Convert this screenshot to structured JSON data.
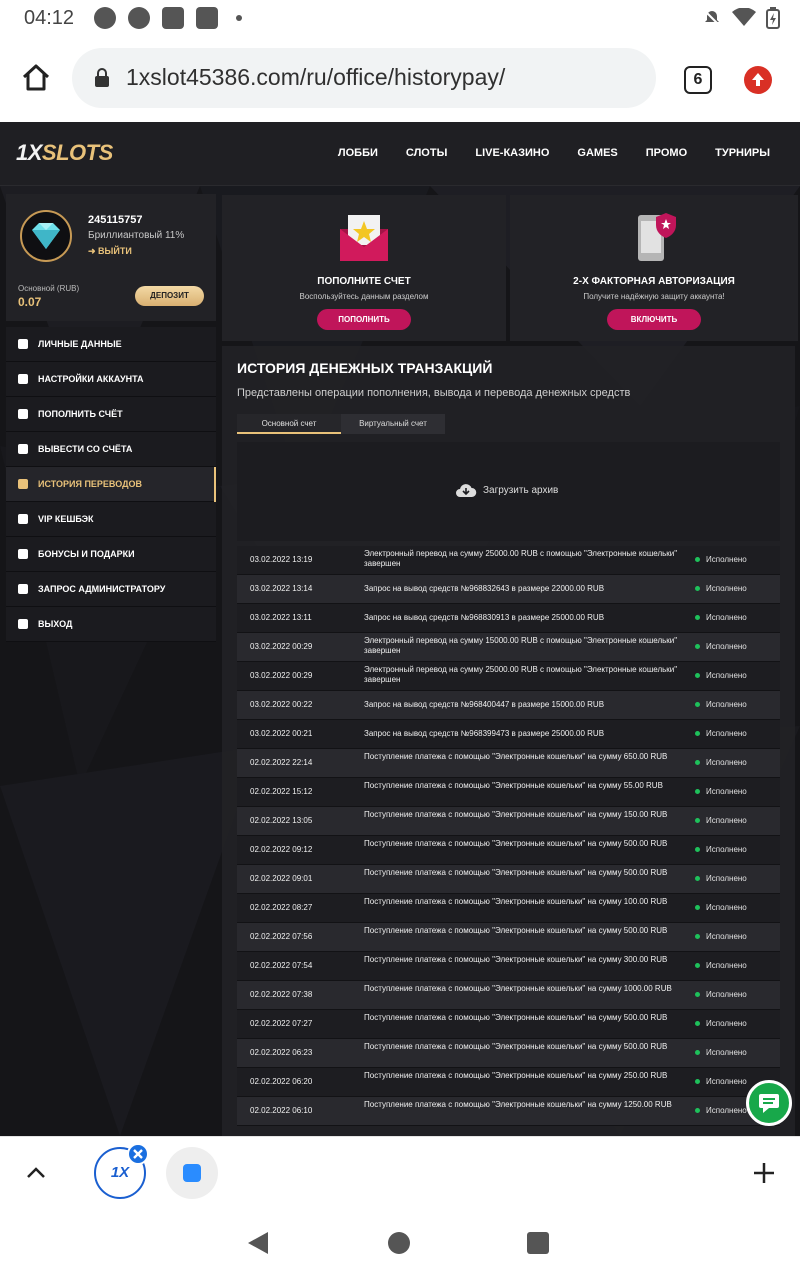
{
  "status_bar": {
    "time": "04:12"
  },
  "browser": {
    "url": "1xslot45386.com/ru/office/historypay/",
    "tab_count": "6"
  },
  "site": {
    "logo_1x": "1X",
    "logo_slots": "SLOTS",
    "nav": [
      "ЛОББИ",
      "СЛОТЫ",
      "LIVE-КАЗИНО",
      "GAMES",
      "ПРОМО",
      "ТУРНИРЫ"
    ]
  },
  "profile": {
    "id": "245115757",
    "level": "Бриллиантовый 11%",
    "logout": "ВЫЙТИ",
    "balance_label": "Основной (RUB)",
    "balance": "0.07",
    "deposit_button": "ДЕПОЗИТ"
  },
  "sidebar": {
    "items": [
      {
        "label": "ЛИЧНЫЕ ДАННЫЕ",
        "icon": "user-icon"
      },
      {
        "label": "НАСТРОЙКИ АККАУНТА",
        "icon": "gear-icon"
      },
      {
        "label": "ПОПОЛНИТЬ СЧЁТ",
        "icon": "download-icon"
      },
      {
        "label": "ВЫВЕСТИ СО СЧЁТА",
        "icon": "upload-icon"
      },
      {
        "label": "ИСТОРИЯ ПЕРЕВОДОВ",
        "icon": "transfer-icon",
        "active": true
      },
      {
        "label": "VIP КЕШБЭК",
        "icon": "crown-icon"
      },
      {
        "label": "БОНУСЫ И ПОДАРКИ",
        "icon": "gift-icon"
      },
      {
        "label": "ЗАПРОС АДМИНИСТРАТОРУ",
        "icon": "envelope-icon"
      },
      {
        "label": "ВЫХОД",
        "icon": "exit-icon"
      }
    ]
  },
  "promos": [
    {
      "title": "ПОПОЛНИТЕ СЧЕТ",
      "desc": "Воспользуйтесь данным разделом",
      "button": "ПОПОЛНИТЬ",
      "icon": "envelope-star-icon"
    },
    {
      "title": "2-Х ФАКТОРНАЯ АВТОРИЗАЦИЯ",
      "desc": "Получите надёжную защиту аккаунта!",
      "button": "ВКЛЮЧИТЬ",
      "icon": "phone-shield-icon"
    }
  ],
  "history": {
    "title": "ИСТОРИЯ ДЕНЕЖНЫХ ТРАНЗАКЦИЙ",
    "subtitle": "Представлены операции пополнения, вывода и перевода денежных средств",
    "tabs": [
      "Основной счет",
      "Виртуальный счет"
    ],
    "archive_label": "Загрузить архив",
    "rows": [
      {
        "date": "03.02.2022 13:19",
        "desc": "Электронный перевод на сумму 25000.00 RUB с помощью \"Электронные кошельки\" завершен",
        "status": "Исполнено"
      },
      {
        "date": "03.02.2022 13:14",
        "desc": "Запрос на вывод средств №968832643 в размере 22000.00 RUB",
        "status": "Исполнено"
      },
      {
        "date": "03.02.2022 13:11",
        "desc": "Запрос на вывод средств №968830913 в размере 25000.00 RUB",
        "status": "Исполнено"
      },
      {
        "date": "03.02.2022 00:29",
        "desc": "Электронный перевод на сумму 15000.00 RUB с помощью \"Электронные кошельки\" завершен",
        "status": "Исполнено"
      },
      {
        "date": "03.02.2022 00:29",
        "desc": "Электронный перевод на сумму 25000.00 RUB с помощью \"Электронные кошельки\" завершен",
        "status": "Исполнено"
      },
      {
        "date": "03.02.2022 00:22",
        "desc": "Запрос на вывод средств №968400447 в размере 15000.00 RUB",
        "status": "Исполнено"
      },
      {
        "date": "03.02.2022 00:21",
        "desc": "Запрос на вывод средств №968399473 в размере 25000.00 RUB",
        "status": "Исполнено"
      },
      {
        "date": "02.02.2022 22:14",
        "desc": "Поступление платежа с помощью \"Электронные кошельки\" на сумму 650.00 RUB",
        "status": "Исполнено"
      },
      {
        "date": "02.02.2022 15:12",
        "desc": "Поступление платежа с помощью \"Электронные кошельки\" на сумму 55.00 RUB",
        "status": "Исполнено"
      },
      {
        "date": "02.02.2022 13:05",
        "desc": "Поступление платежа с помощью \"Электронные кошельки\" на сумму 150.00 RUB",
        "status": "Исполнено"
      },
      {
        "date": "02.02.2022 09:12",
        "desc": "Поступление платежа с помощью \"Электронные кошельки\" на сумму 500.00 RUB",
        "status": "Исполнено"
      },
      {
        "date": "02.02.2022 09:01",
        "desc": "Поступление платежа с помощью \"Электронные кошельки\" на сумму 500.00 RUB",
        "status": "Исполнено"
      },
      {
        "date": "02.02.2022 08:27",
        "desc": "Поступление платежа с помощью \"Электронные кошельки\" на сумму 100.00 RUB",
        "status": "Исполнено"
      },
      {
        "date": "02.02.2022 07:56",
        "desc": "Поступление платежа с помощью \"Электронные кошельки\" на сумму 500.00 RUB",
        "status": "Исполнено"
      },
      {
        "date": "02.02.2022 07:54",
        "desc": "Поступление платежа с помощью \"Электронные кошельки\" на сумму 300.00 RUB",
        "status": "Исполнено"
      },
      {
        "date": "02.02.2022 07:38",
        "desc": "Поступление платежа с помощью \"Электронные кошельки\" на сумму 1000.00 RUB",
        "status": "Исполнено"
      },
      {
        "date": "02.02.2022 07:27",
        "desc": "Поступление платежа с помощью \"Электронные кошельки\" на сумму 500.00 RUB",
        "status": "Исполнено"
      },
      {
        "date": "02.02.2022 06:23",
        "desc": "Поступление платежа с помощью \"Электронные кошельки\" на сумму 500.00 RUB",
        "status": "Исполнено"
      },
      {
        "date": "02.02.2022 06:20",
        "desc": "Поступление платежа с помощью \"Электронные кошельки\" на сумму 250.00 RUB",
        "status": "Исполнено"
      },
      {
        "date": "02.02.2022 06:10",
        "desc": "Поступление платежа с помощью \"Электронные кошельки\" на сумму 1250.00 RUB",
        "status": "Исполнено"
      }
    ]
  },
  "bottom_bar": {
    "tab_thumb_text": "1X"
  },
  "colors": {
    "accent": "#e9c27a",
    "promo_button": "#c0155a",
    "status_ok": "#1ec15b",
    "chat": "#18a84a"
  }
}
